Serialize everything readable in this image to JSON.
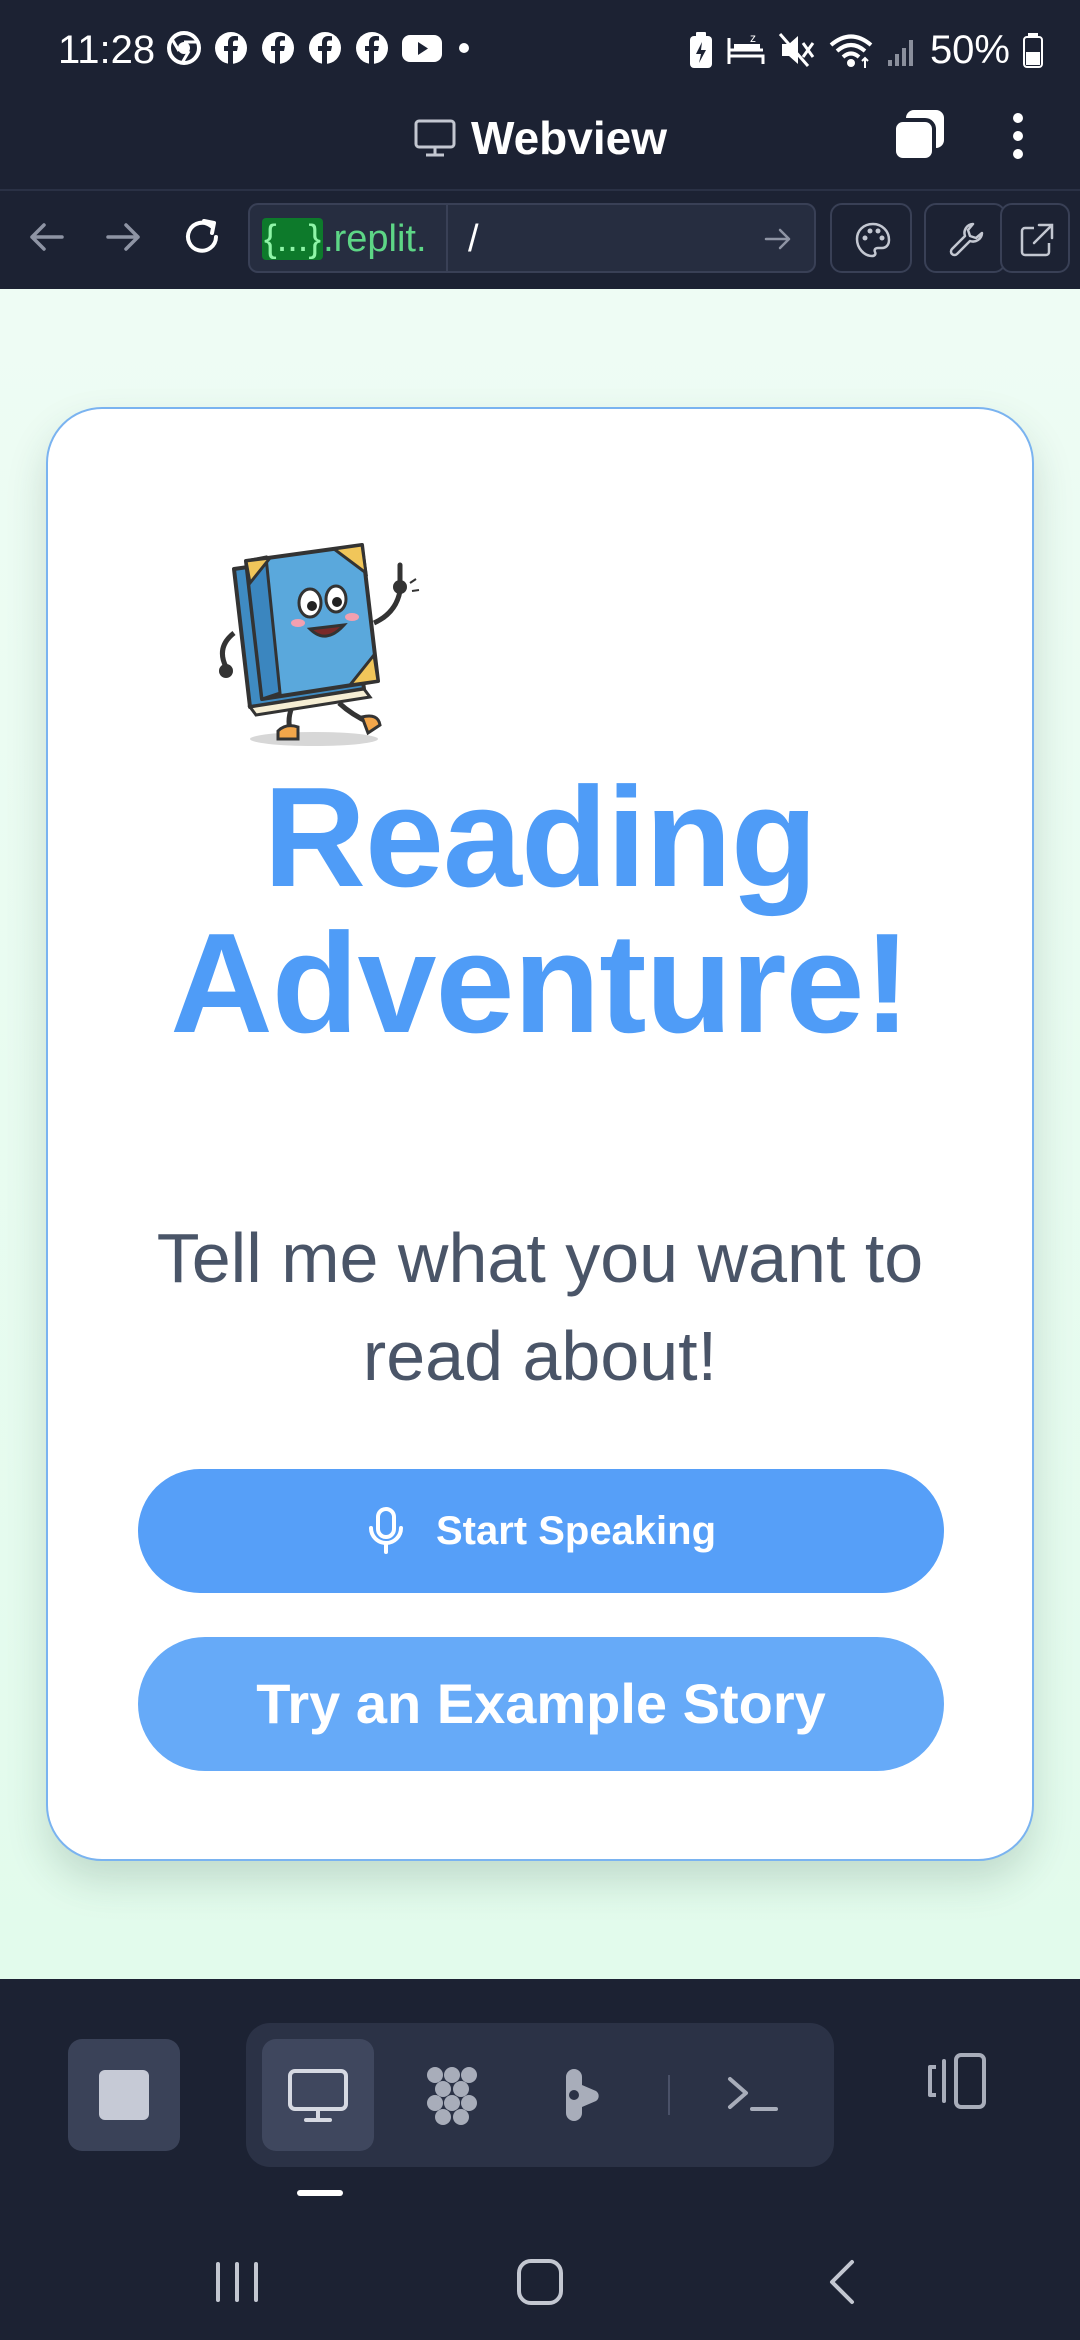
{
  "status_bar": {
    "time": "11:28",
    "battery": "50%",
    "notification_icons": [
      "chrome-icon",
      "facebook-icon",
      "facebook-icon",
      "facebook-icon",
      "facebook-icon",
      "youtube-icon",
      "more-dot-icon"
    ],
    "system_icons": [
      "battery-saver-icon",
      "sleep-mode-icon",
      "mute-icon",
      "wifi-icon",
      "signal-icon",
      "battery-icon"
    ]
  },
  "title_bar": {
    "title": "Webview",
    "icons": [
      "monitor-icon",
      "tabs-icon",
      "more-vertical-icon"
    ]
  },
  "url_bar": {
    "domain_prefix": "{...}",
    "domain_suffix": ".replit.",
    "path": "/",
    "icons": [
      "back-arrow-icon",
      "forward-arrow-icon",
      "reload-icon",
      "go-arrow-icon",
      "palette-icon",
      "wrench-icon",
      "open-external-icon"
    ]
  },
  "page": {
    "headline_line1": "Reading",
    "headline_line2": "Adventure!",
    "subtitle": "Tell me what you want to read about!",
    "start_button_label": "Start Speaking",
    "example_button_label": "Try an Example Story",
    "mascot": "book-mascot-illustration"
  },
  "bottom_toolbar": {
    "icons": [
      "stop-icon",
      "webview-pane-icon",
      "packages-icon",
      "agent-icon",
      "shell-icon",
      "layout-icon"
    ],
    "active_pane": "webview"
  },
  "android_nav": {
    "icons": [
      "recents-icon",
      "home-icon",
      "back-icon"
    ]
  },
  "colors": {
    "chrome_bg": "#1c2233",
    "accent_blue": "#569ff8",
    "headline_blue": "#4f9cf7",
    "page_bg": "#e6fbef",
    "url_green": "#5dd686"
  }
}
